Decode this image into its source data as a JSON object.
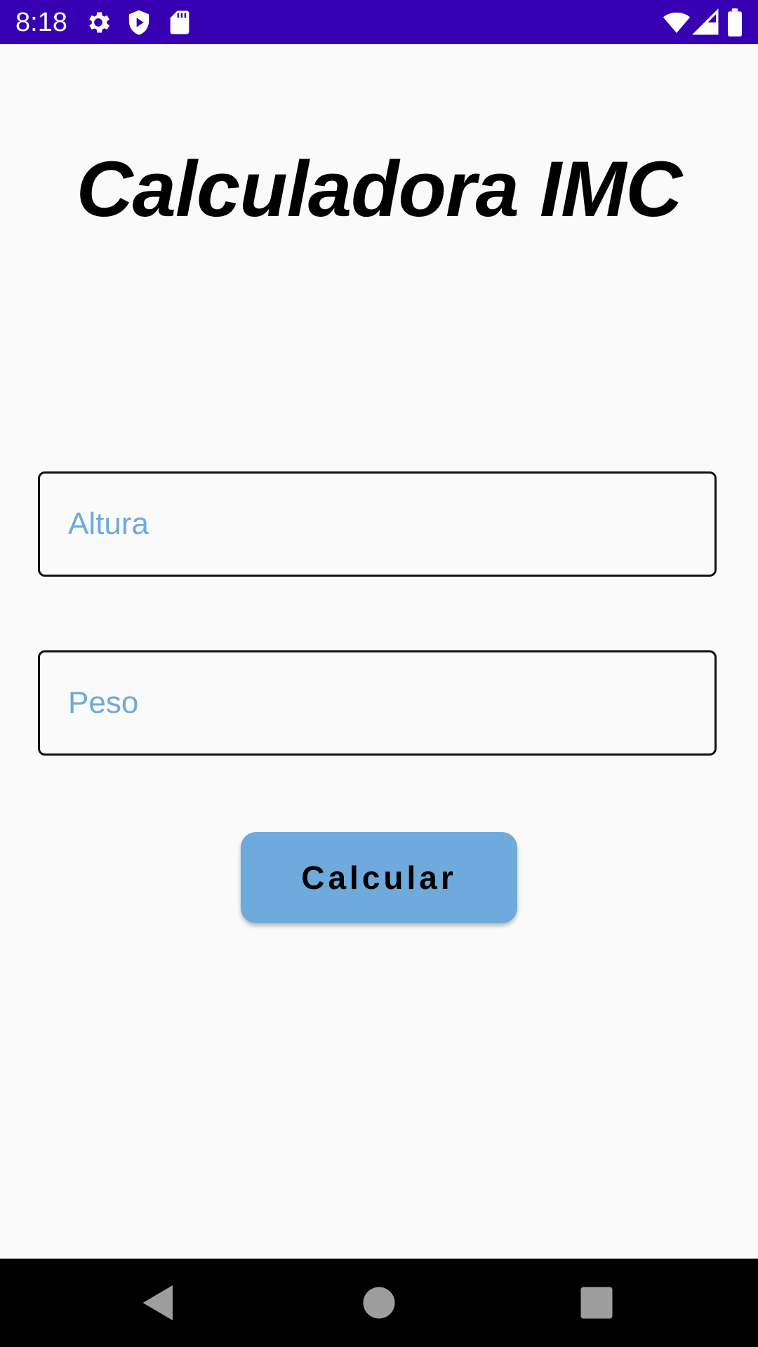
{
  "status_bar": {
    "time": "8:18",
    "icons": [
      "gear-icon",
      "play-protect-icon",
      "sd-card-icon",
      "wifi-icon",
      "signal-icon",
      "battery-icon"
    ],
    "background": "#3700b3"
  },
  "main": {
    "title": "Calculadora IMC",
    "altura_field": {
      "placeholder": "Altura",
      "value": ""
    },
    "peso_field": {
      "placeholder": "Peso",
      "value": ""
    },
    "calculate_button": {
      "label": "Calcular",
      "color": "#6eaadb"
    }
  },
  "colors": {
    "placeholder": "#6eaad9",
    "background": "#fafafa"
  },
  "nav_bar": {
    "buttons": [
      "back-icon",
      "home-icon",
      "recents-icon"
    ]
  }
}
